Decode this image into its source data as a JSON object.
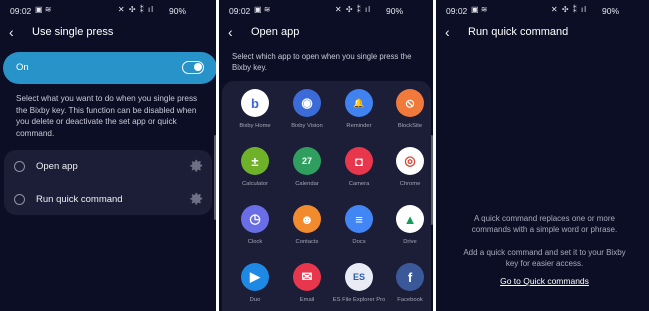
{
  "status": {
    "time": "09:02",
    "battery": "90%"
  },
  "screen1": {
    "title": "Use single press",
    "toggle_label": "On",
    "toggle_state": "on",
    "accent": "#2793c8",
    "description": "Select what you want to do when you single press the Bixby key. This function can be disabled when you delete or deactivate the set app or quick command.",
    "options": [
      {
        "label": "Open app"
      },
      {
        "label": "Run quick command"
      }
    ]
  },
  "screen2": {
    "title": "Open app",
    "description": "Select which app to open when you single press the Bixby key.",
    "apps": [
      {
        "name": "Bixby Home",
        "icon": "bixby-home-icon",
        "color": "#ffffff",
        "glyph": "b",
        "fg": "#3c64d8"
      },
      {
        "name": "Bixby Vision",
        "icon": "bixby-vision-icon",
        "color": "#3b6bd9",
        "glyph": "◉",
        "fg": "#ffffff"
      },
      {
        "name": "Reminder",
        "icon": "reminder-icon",
        "color": "#3f82f0",
        "glyph": "🔔",
        "fg": "#ffffff"
      },
      {
        "name": "BlockSite",
        "icon": "blocksite-icon",
        "color": "#f07a3c",
        "glyph": "⦸",
        "fg": "#ffffff"
      },
      {
        "name": "Calculator",
        "icon": "calculator-icon",
        "color": "#6fb22a",
        "glyph": "±",
        "fg": "#ffffff"
      },
      {
        "name": "Calendar",
        "icon": "calendar-icon",
        "color": "#2f9e5e",
        "glyph": "27",
        "fg": "#ffffff"
      },
      {
        "name": "Camera",
        "icon": "camera-icon",
        "color": "#e8374d",
        "glyph": "◘",
        "fg": "#ffffff"
      },
      {
        "name": "Chrome",
        "icon": "chrome-icon",
        "color": "#ffffff",
        "glyph": "◎",
        "fg": "#db4437"
      },
      {
        "name": "Clock",
        "icon": "clock-icon",
        "color": "#6a6ee6",
        "glyph": "◷",
        "fg": "#ffffff"
      },
      {
        "name": "Contacts",
        "icon": "contacts-icon",
        "color": "#f28a2e",
        "glyph": "☻",
        "fg": "#ffffff"
      },
      {
        "name": "Docs",
        "icon": "docs-icon",
        "color": "#4285f4",
        "glyph": "≡",
        "fg": "#ffffff"
      },
      {
        "name": "Drive",
        "icon": "drive-icon",
        "color": "#ffffff",
        "glyph": "▲",
        "fg": "#0f9d58"
      },
      {
        "name": "Duo",
        "icon": "duo-icon",
        "color": "#1e88e5",
        "glyph": "▶",
        "fg": "#ffffff"
      },
      {
        "name": "Email",
        "icon": "email-icon",
        "color": "#e8374d",
        "glyph": "✉",
        "fg": "#ffffff"
      },
      {
        "name": "ES File Explorer Pro",
        "icon": "es-file-explorer-icon",
        "color": "#e9ecf4",
        "glyph": "ES",
        "fg": "#2a5db0"
      },
      {
        "name": "Facebook",
        "icon": "facebook-icon",
        "color": "#3b5998",
        "glyph": "f",
        "fg": "#ffffff"
      }
    ]
  },
  "screen3": {
    "title": "Run quick command",
    "empty_line1": "A quick command replaces one or more commands with a simple word or phrase.",
    "empty_line2": "Add a quick command and set it to your Bixby key for easier access.",
    "link": "Go to Quick commands"
  }
}
